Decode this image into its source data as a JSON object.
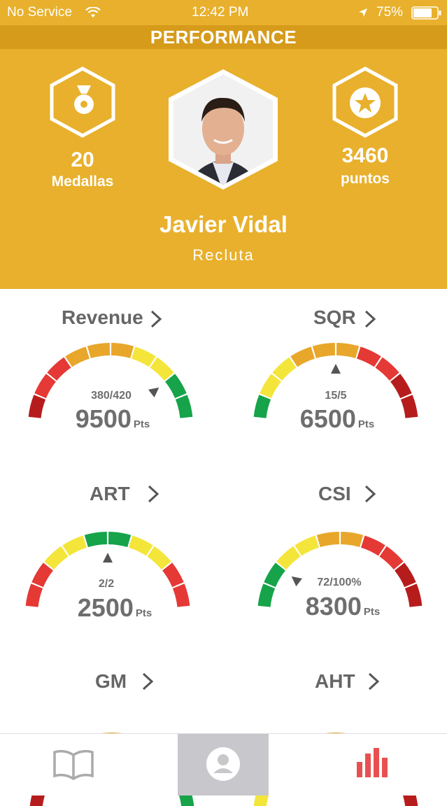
{
  "status_bar": {
    "carrier": "No Service",
    "time": "12:42 PM",
    "battery": "75%"
  },
  "title": "PERFORMANCE",
  "profile": {
    "name": "Javier Vidal",
    "rank": "Recluta",
    "medals_count": "20",
    "medals_label": "Medallas",
    "points_count": "3460",
    "points_label": "puntos"
  },
  "metrics": [
    {
      "title": "Revenue",
      "fraction": "380/420",
      "points": "9500",
      "unit": "Pts"
    },
    {
      "title": "SQR",
      "fraction": "15/5",
      "points": "6500",
      "unit": "Pts"
    },
    {
      "title": "ART",
      "fraction": "2/2",
      "points": "2500",
      "unit": "Pts"
    },
    {
      "title": "CSI",
      "fraction": "72/100%",
      "points": "8300",
      "unit": "Pts"
    },
    {
      "title": "GM",
      "fraction": "",
      "points": "",
      "unit": ""
    },
    {
      "title": "AHT",
      "fraction": "",
      "points": "",
      "unit": ""
    }
  ],
  "colors": {
    "header": "#e8b02c",
    "title_bar": "#d69b1b",
    "text_gray": "#666666",
    "active_tab": "#c8c8cc",
    "chart_red": "#e85050"
  },
  "tabbar": {
    "icons": [
      "book-icon",
      "profile-icon",
      "bar-chart-icon"
    ]
  }
}
